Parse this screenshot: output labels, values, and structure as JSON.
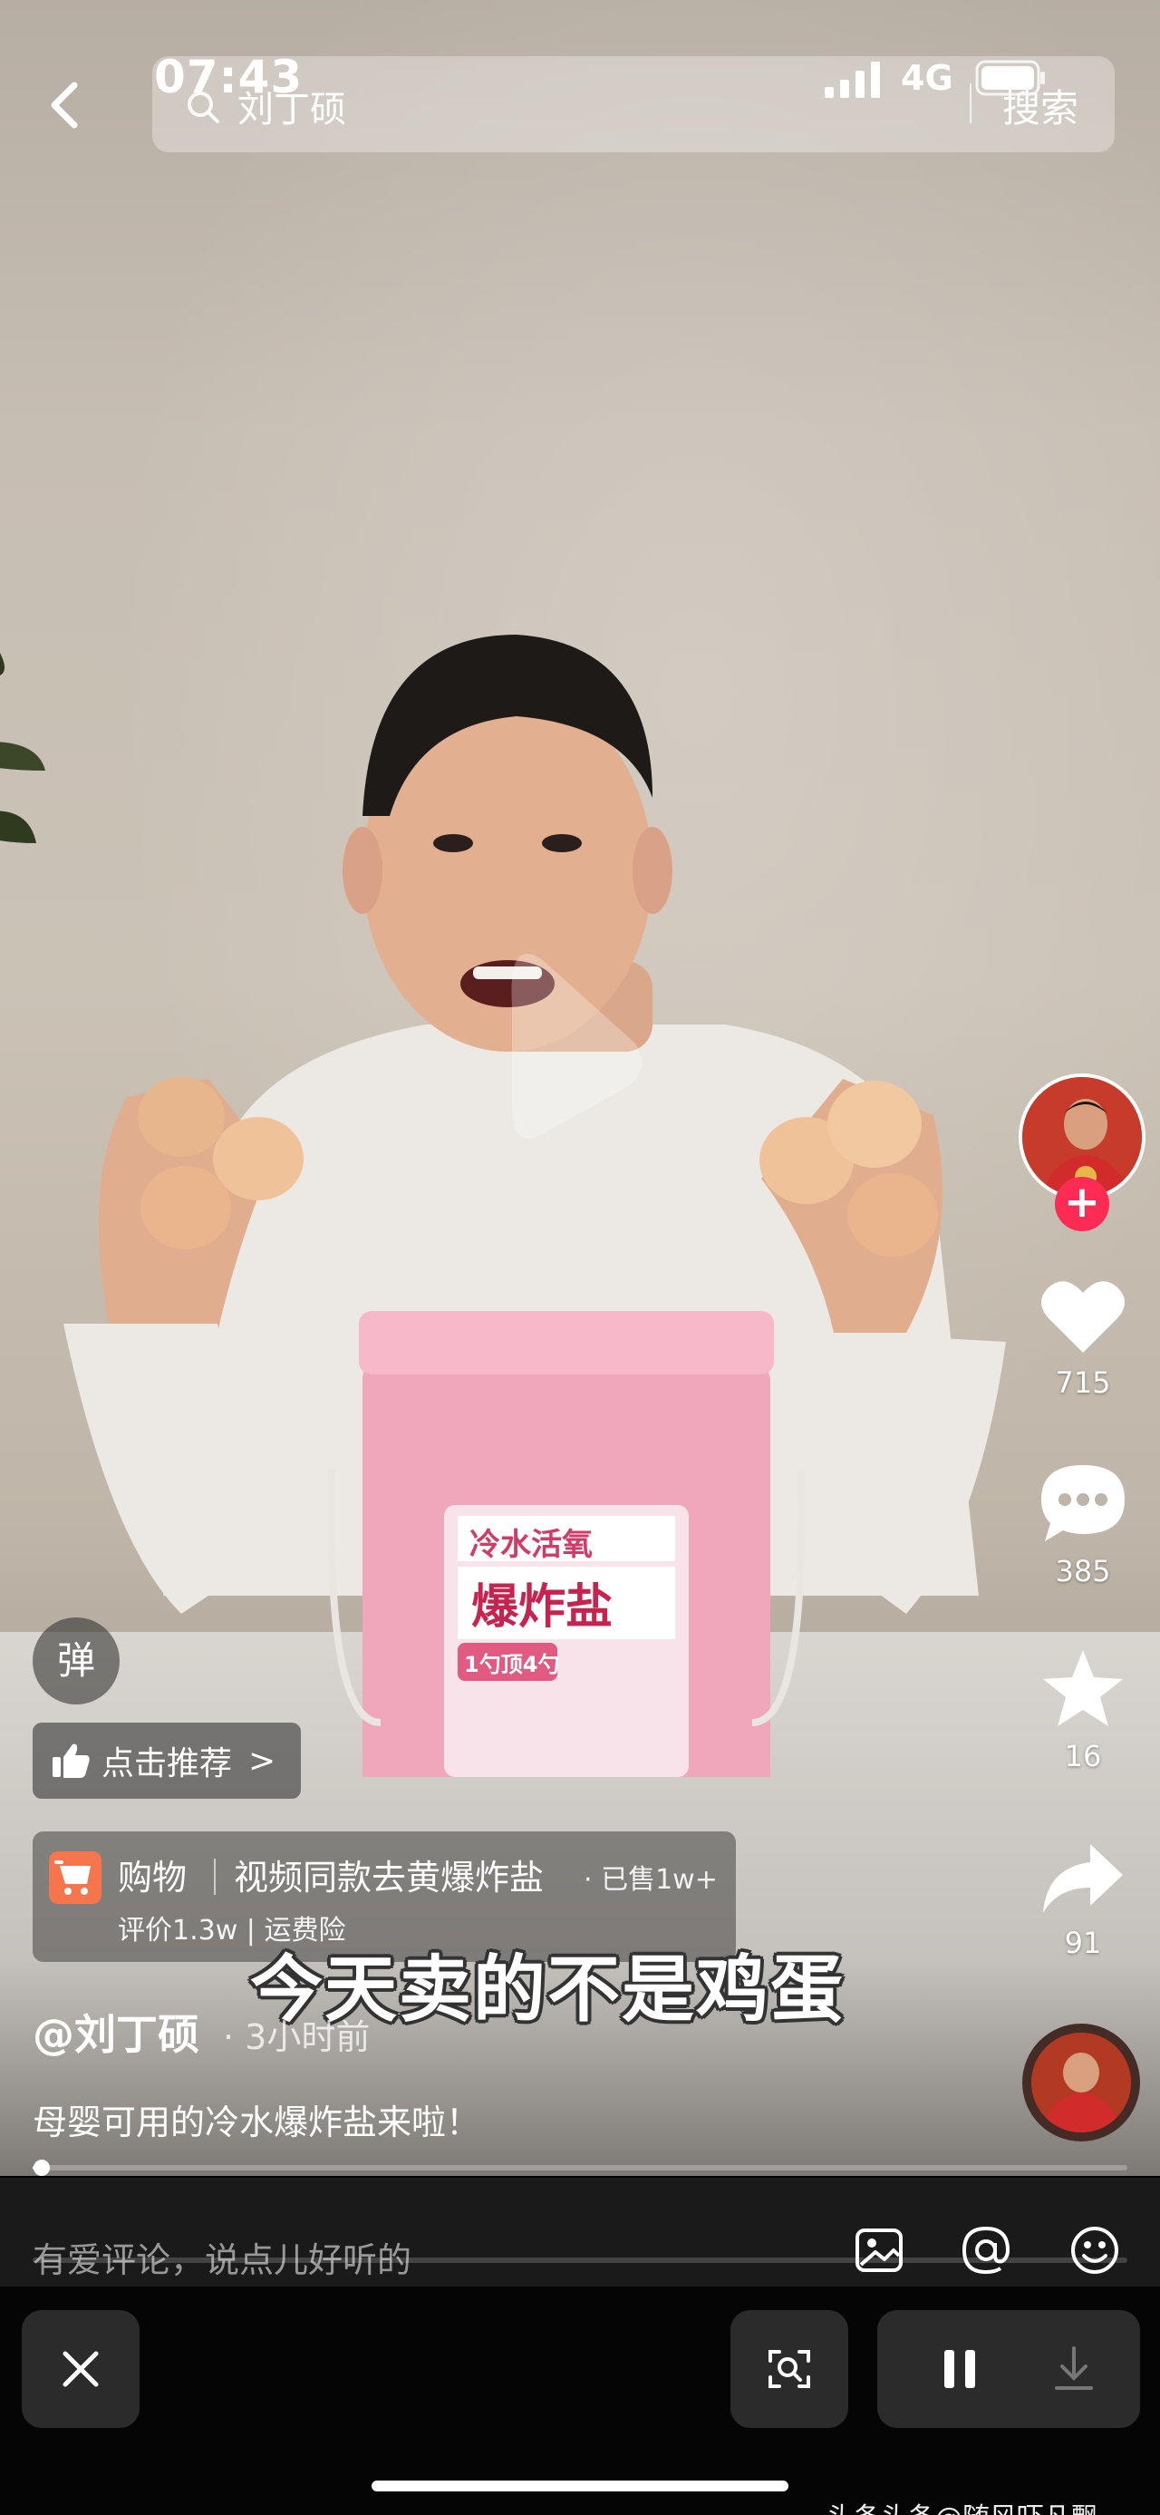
{
  "status_bar": {
    "time": "07:43",
    "network": "4G"
  },
  "search": {
    "query": "刘丁硕",
    "button_label": "搜索"
  },
  "rail": {
    "likes": "715",
    "comments": "385",
    "favorites": "16",
    "shares": "91",
    "follow_label": "+"
  },
  "overlays": {
    "danmu_label": "弹",
    "recommend_label": "点击推荐",
    "recommend_chevron": ">"
  },
  "shop": {
    "label": "购物",
    "title": "视频同款去黄爆炸盐",
    "sold": "· 已售1w+",
    "rating": "评价1.3w",
    "insurance": "运费险"
  },
  "video": {
    "subtitle": "今天卖的不是鸡蛋",
    "author": "@刘丁硕",
    "time_ago": "· 3小时前",
    "caption": "母婴可用的冷水爆炸盐来啦！",
    "progress": 0.008
  },
  "product_box": {
    "brand_line": "冷水活氧",
    "product_name": "爆炸盐",
    "tag": "1勺顶4勺"
  },
  "comment": {
    "placeholder": "有爱评论，说点儿好听的"
  },
  "watermark": "头条头条@随风吓凡飘"
}
